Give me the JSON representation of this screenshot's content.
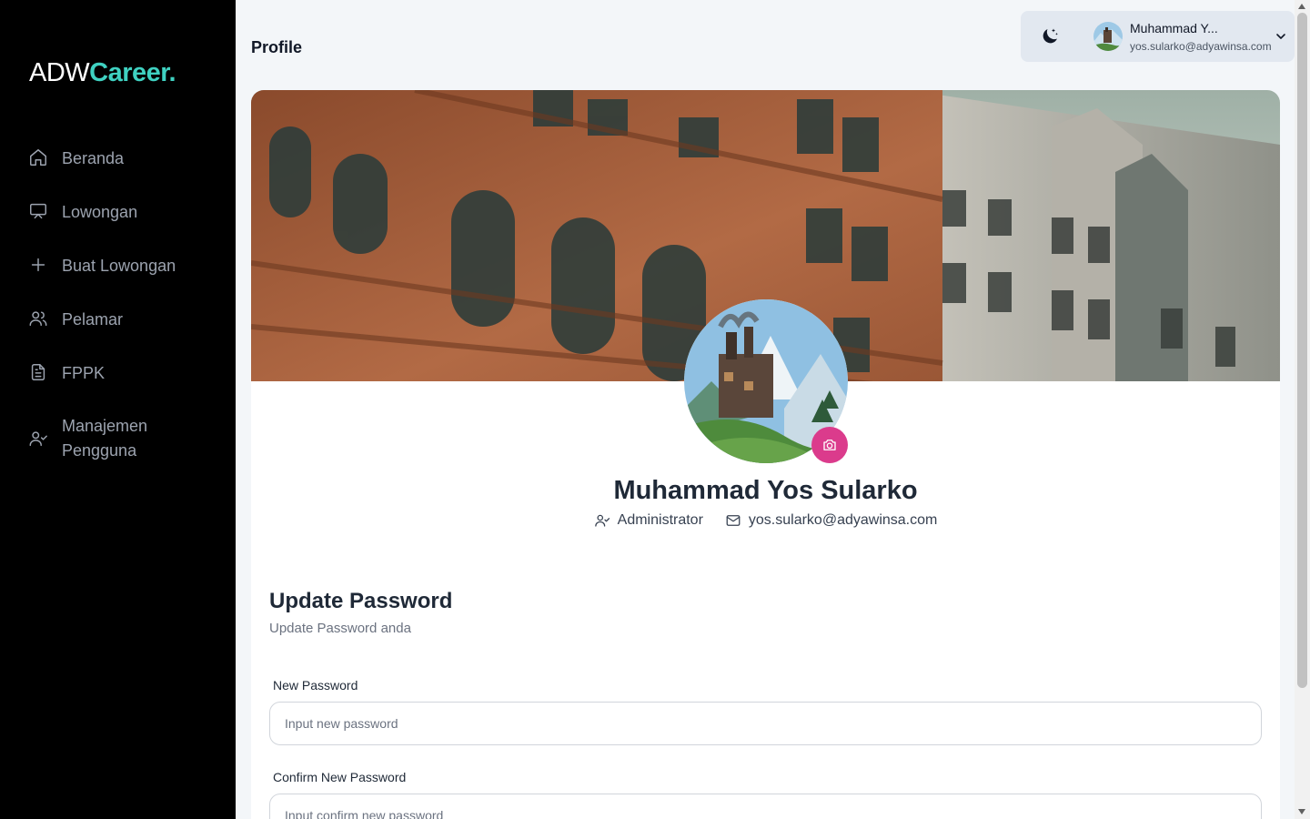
{
  "brand": {
    "part1": "ADW",
    "part2": "Career."
  },
  "sidebar": {
    "items": [
      {
        "label": "Beranda",
        "icon": "home-icon"
      },
      {
        "label": "Lowongan",
        "icon": "presentation-icon"
      },
      {
        "label": "Buat Lowongan",
        "icon": "plus-icon"
      },
      {
        "label": "Pelamar",
        "icon": "users-icon"
      },
      {
        "label": "FPPK",
        "icon": "document-icon"
      },
      {
        "label": "Manajemen Pengguna",
        "icon": "user-check-icon"
      }
    ]
  },
  "header": {
    "title": "Profile",
    "user_name": "Muhammad Y...",
    "user_email": "yos.sularko@adyawinsa.com"
  },
  "profile": {
    "name": "Muhammad Yos Sularko",
    "role": "Administrator",
    "email": "yos.sularko@adyawinsa.com"
  },
  "password_section": {
    "title": "Update Password",
    "subtitle": "Update Password anda",
    "new_label": "New Password",
    "new_placeholder": "Input new password",
    "confirm_label": "Confirm New Password",
    "confirm_placeholder": "Input confirm new password"
  },
  "colors": {
    "sidebar_bg": "#000000",
    "brand_accent": "#3fd1c1",
    "camera_button": "#db3b8c",
    "page_bg": "#f3f6f9"
  }
}
